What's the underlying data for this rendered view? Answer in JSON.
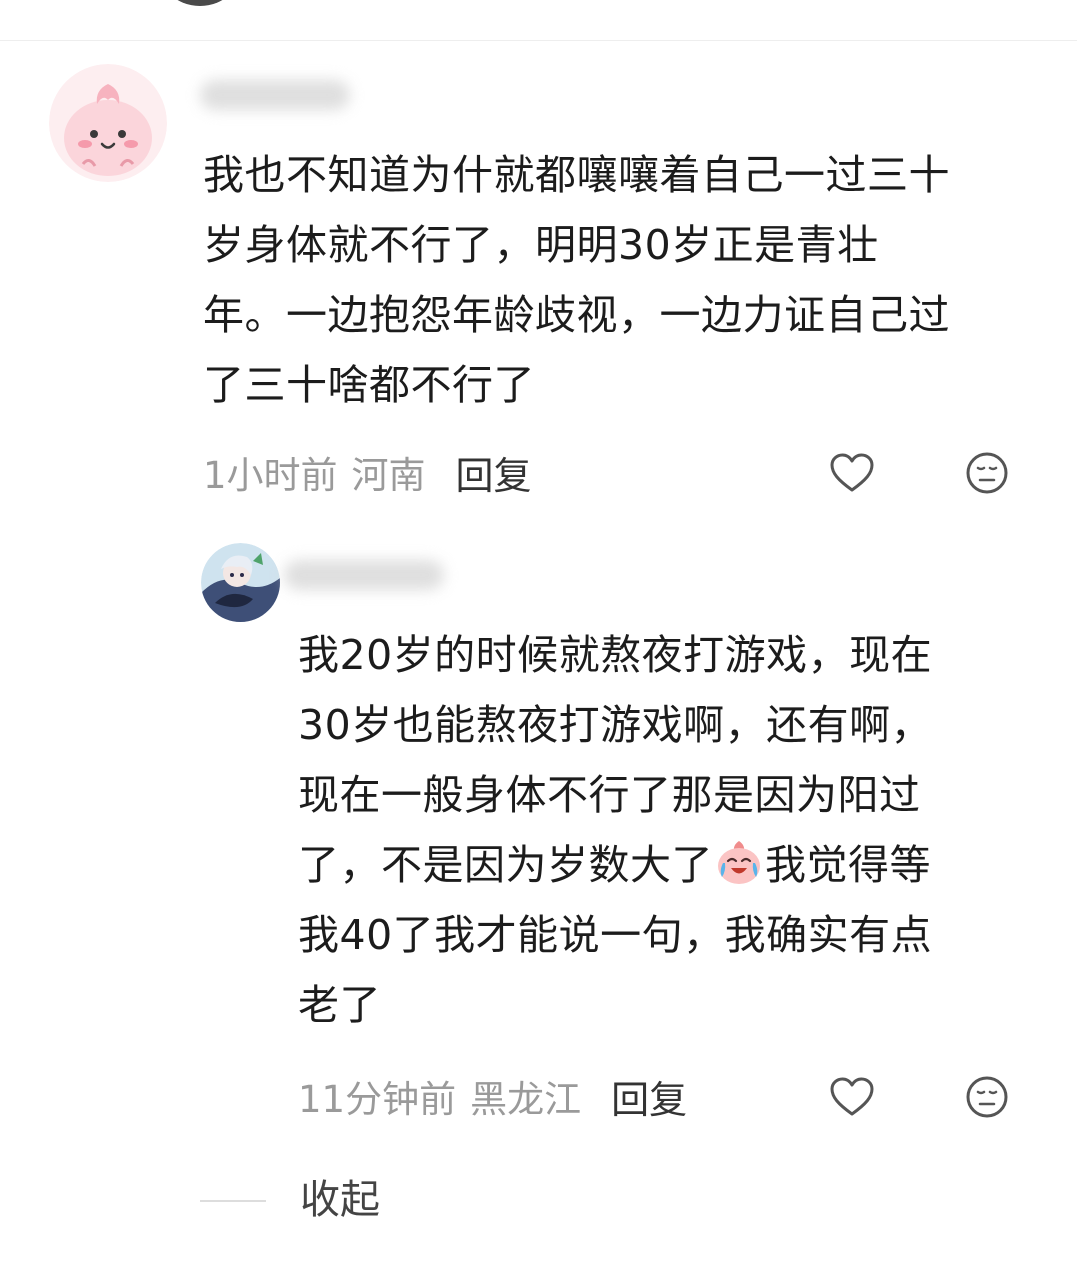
{
  "comments": [
    {
      "text_lines": [
        "我也不知道为什就都嚷嚷着自己一过三十",
        "岁身体就不行了，明明30岁正是青壮",
        "年。一边抱怨年龄歧视，一边力证自己过",
        "了三十啥都不行了"
      ],
      "time": "1小时前",
      "location": "河南",
      "reply_label": "回复",
      "avatar_icon": "peach-cartoon-avatar"
    }
  ],
  "replies": [
    {
      "text_lines": [
        "我20岁的时候就熬夜打游戏，现在",
        "30岁也能熬夜打游戏啊，还有啊，",
        "现在一般身体不行了那是因为阳过",
        "了，不是因为岁数大了",
        "我40了我才能说一句，我确实有点",
        "老了"
      ],
      "emoji": "crying-laughing-emoji",
      "emoji_follow_text": "我觉得等",
      "time": "11分钟前",
      "location": "黑龙江",
      "reply_label": "回复",
      "avatar_icon": "anime-character-avatar"
    }
  ],
  "collapse_label": "收起",
  "colors": {
    "text": "#1c1c1c",
    "meta": "#9a9a9a",
    "reply": "#333333",
    "icon": "#555555"
  }
}
